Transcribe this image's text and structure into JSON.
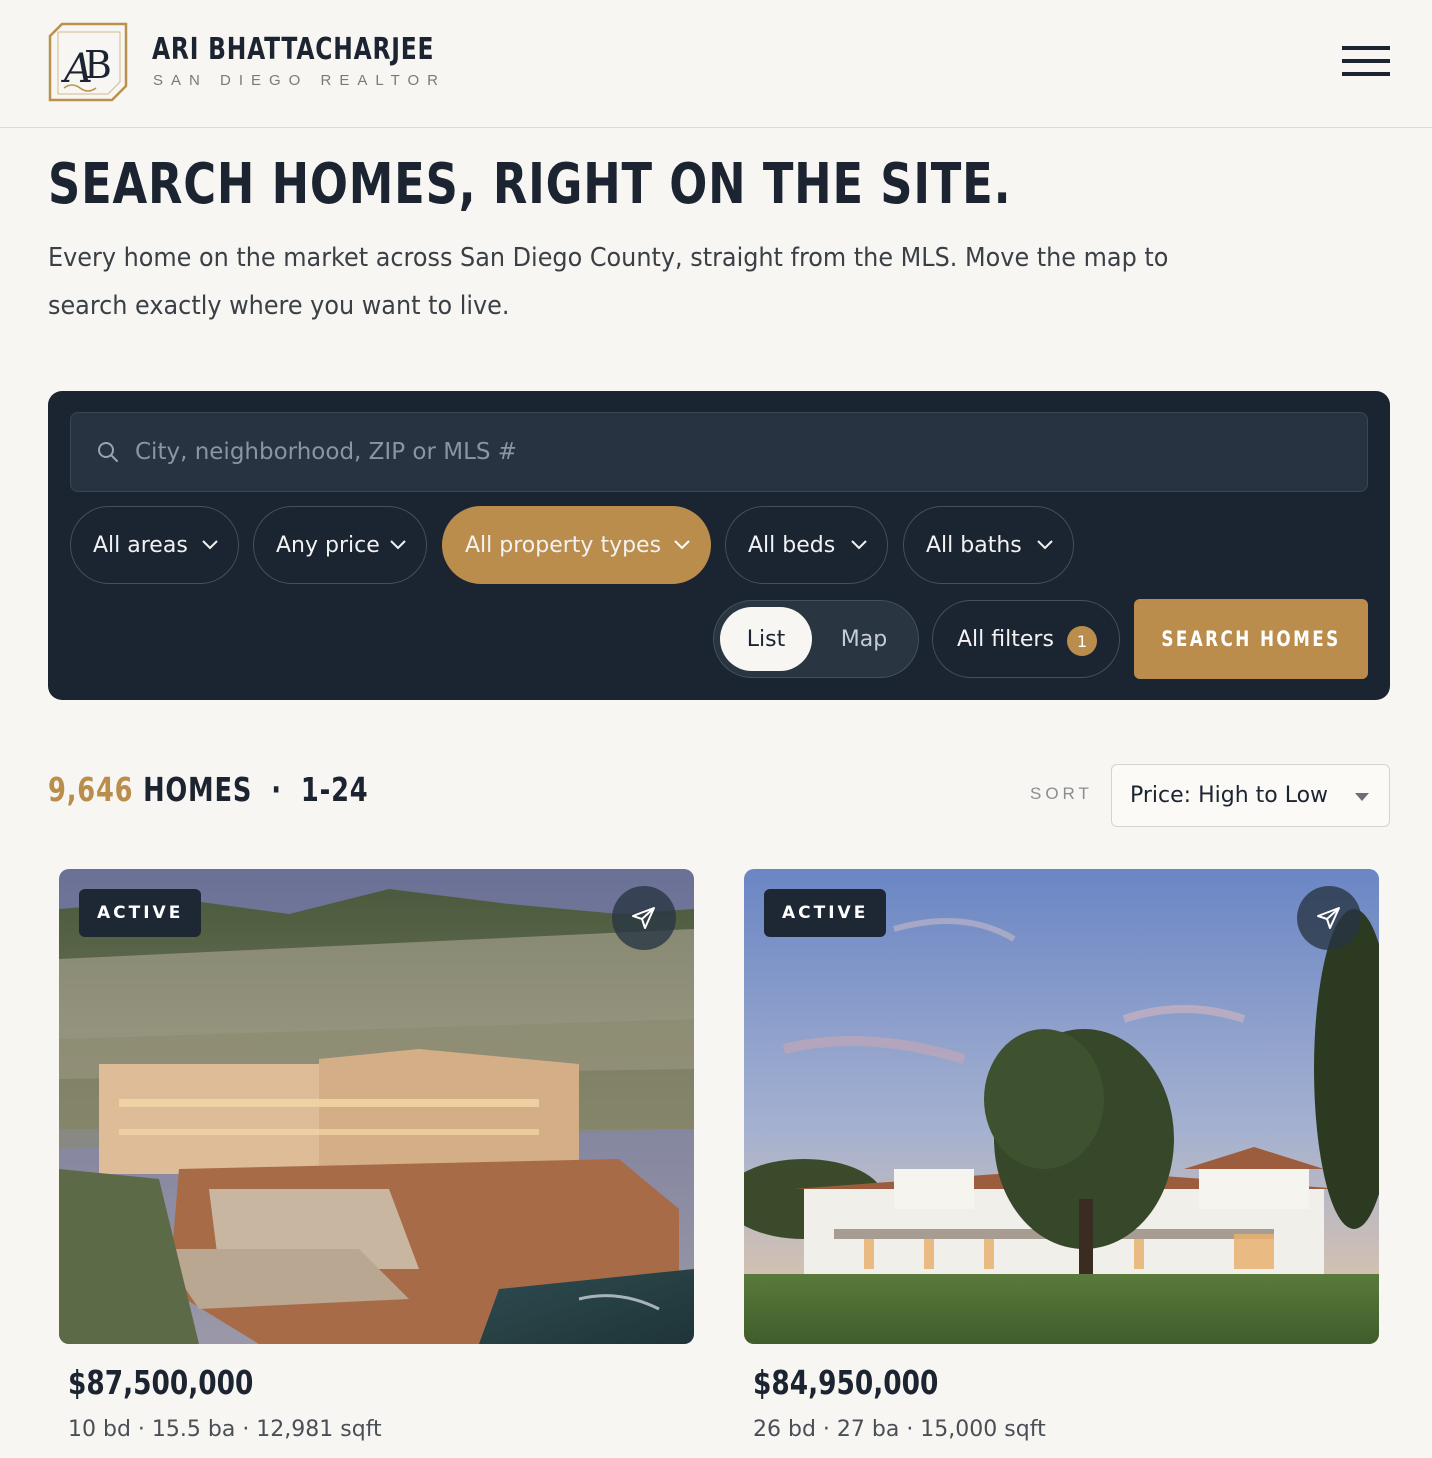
{
  "header": {
    "brand_name": "ARI BHATTACHARJEE",
    "brand_sub": "SAN DIEGO REALTOR",
    "logo_letters": "AB",
    "menu_icon": "hamburger-menu-icon"
  },
  "hero": {
    "title": "SEARCH HOMES, RIGHT ON THE SITE.",
    "intro": "Every home on the market across San Diego County, straight from the MLS. Move the map to search exactly where you want to live."
  },
  "search": {
    "placeholder": "City, neighborhood, ZIP or MLS #",
    "filters": [
      {
        "label": "All areas",
        "active": false
      },
      {
        "label": "Any price",
        "active": false
      },
      {
        "label": "All property types",
        "active": true
      },
      {
        "label": "All beds",
        "active": false
      },
      {
        "label": "All baths",
        "active": false
      }
    ],
    "view_list": "List",
    "view_map": "Map",
    "selected_view": "List",
    "all_filters_label": "All filters",
    "all_filters_count": "1",
    "search_button": "SEARCH HOMES"
  },
  "results": {
    "count": "9,646",
    "count_label": "HOMES",
    "separator": "·",
    "range": "1-24",
    "sort_label": "SORT",
    "sort_value": "Price: High to Low"
  },
  "listings": [
    {
      "status": "ACTIVE",
      "price": "$87,500,000",
      "facts": "10 bd · 15.5 ba · 12,981 sqft"
    },
    {
      "status": "ACTIVE",
      "price": "$84,950,000",
      "facts": "26 bd · 27 ba · 15,000 sqft"
    }
  ],
  "colors": {
    "accent_gold": "#bb8d4c",
    "panel_navy": "#1b2532",
    "page_background": "#f7f6f2",
    "text_dark": "#1b2430"
  }
}
